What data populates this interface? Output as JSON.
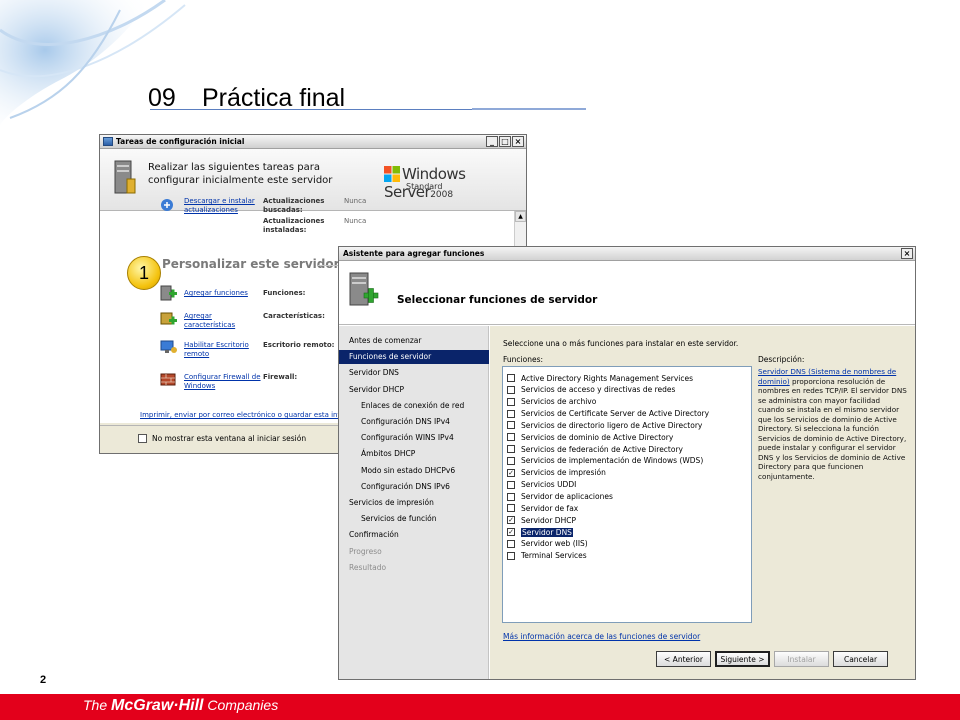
{
  "slide": {
    "number": "09",
    "title": "Práctica final",
    "page": "2",
    "footer_pre": "The ",
    "footer_brand": "McGraw·Hill",
    "footer_post": " Companies"
  },
  "badge": "1",
  "colors": {
    "footer": "#e3001b",
    "selection": "#0a246a",
    "link": "#0033aa"
  },
  "tasks_window": {
    "title": "Tareas de configuración inicial",
    "controls": [
      "_",
      "□",
      "×"
    ],
    "header_text": "Realizar las siguientes tareas para configurar inicialmente este servidor",
    "logo_text": "Windows Server",
    "logo_version": "2008",
    "logo_edition": "Standard",
    "updates": {
      "link": "Descargar e instalar actualizaciones",
      "found_label": "Actualizaciones buscadas:",
      "found_value": "Nunca",
      "installed_label": "Actualizaciones instaladas:",
      "installed_value": "Nunca"
    },
    "section_title": "Personalizar este servidor",
    "tasks": [
      {
        "link": "Agregar funciones",
        "label": "Funciones:"
      },
      {
        "link": "Agregar características",
        "label": "Características:"
      },
      {
        "link": "Habilitar Escritorio remoto",
        "label": "Escritorio remoto:"
      },
      {
        "link": "Configurar Firewall de Windows",
        "label": "Firewall:"
      }
    ],
    "print_link": "Imprimir, enviar por correo electrónico o guardar esta inform",
    "checkbox_label": "No mostrar esta ventana al iniciar sesión"
  },
  "wizard": {
    "title": "Asistente para agregar funciones",
    "close": "×",
    "heading": "Seleccionar funciones de servidor",
    "nav": [
      {
        "label": "Antes de comenzar",
        "level": 0,
        "state": "normal"
      },
      {
        "label": "Funciones de servidor",
        "level": 0,
        "state": "active"
      },
      {
        "label": "Servidor DNS",
        "level": 0,
        "state": "normal"
      },
      {
        "label": "Servidor DHCP",
        "level": 0,
        "state": "normal"
      },
      {
        "label": "Enlaces de conexión de red",
        "level": 1,
        "state": "normal"
      },
      {
        "label": "Configuración DNS IPv4",
        "level": 1,
        "state": "normal"
      },
      {
        "label": "Configuración WINS IPv4",
        "level": 1,
        "state": "normal"
      },
      {
        "label": "Ámbitos DHCP",
        "level": 1,
        "state": "normal"
      },
      {
        "label": "Modo sin estado DHCPv6",
        "level": 1,
        "state": "normal"
      },
      {
        "label": "Configuración DNS IPv6",
        "level": 1,
        "state": "normal"
      },
      {
        "label": "Servicios de impresión",
        "level": 0,
        "state": "normal"
      },
      {
        "label": "Servicios de función",
        "level": 1,
        "state": "normal"
      },
      {
        "label": "Confirmación",
        "level": 0,
        "state": "normal"
      },
      {
        "label": "Progreso",
        "level": 0,
        "state": "disabled"
      },
      {
        "label": "Resultado",
        "level": 0,
        "state": "disabled"
      }
    ],
    "instruction": "Seleccione una o más funciones para instalar en este servidor.",
    "roles_label": "Funciones:",
    "roles": [
      {
        "label": "Active Directory Rights Management Services",
        "checked": false,
        "selected": false
      },
      {
        "label": "Servicios de acceso y directivas de redes",
        "checked": false,
        "selected": false
      },
      {
        "label": "Servicios de archivo",
        "checked": false,
        "selected": false
      },
      {
        "label": "Servicios de Certificate Server de Active Directory",
        "checked": false,
        "selected": false
      },
      {
        "label": "Servicios de directorio ligero de Active Directory",
        "checked": false,
        "selected": false
      },
      {
        "label": "Servicios de dominio de Active Directory",
        "checked": false,
        "selected": false
      },
      {
        "label": "Servicios de federación de Active Directory",
        "checked": false,
        "selected": false
      },
      {
        "label": "Servicios de implementación de Windows (WDS)",
        "checked": false,
        "selected": false
      },
      {
        "label": "Servicios de impresión",
        "checked": true,
        "selected": false
      },
      {
        "label": "Servicios UDDI",
        "checked": false,
        "selected": false
      },
      {
        "label": "Servidor de aplicaciones",
        "checked": false,
        "selected": false
      },
      {
        "label": "Servidor de fax",
        "checked": false,
        "selected": false
      },
      {
        "label": "Servidor DHCP",
        "checked": true,
        "selected": false
      },
      {
        "label": "Servidor DNS",
        "checked": true,
        "selected": true
      },
      {
        "label": "Servidor web (IIS)",
        "checked": false,
        "selected": false
      },
      {
        "label": "Terminal Services",
        "checked": false,
        "selected": false
      }
    ],
    "description_label": "Descripción:",
    "description_link": "Servidor DNS (Sistema de nombres de dominio)",
    "description_text": " proporciona resolución de nombres en redes TCP/IP. El servidor DNS se administra con mayor facilidad cuando se instala en el mismo servidor que los Servicios de dominio de Active Directory. Si selecciona la función Servicios de dominio de Active Directory, puede instalar y configurar el servidor DNS y los Servicios de dominio de Active Directory para que funcionen conjuntamente.",
    "more_link": "Más información acerca de las funciones de servidor",
    "buttons": {
      "back": "< Anterior",
      "next": "Siguiente >",
      "install": "Instalar",
      "cancel": "Cancelar"
    }
  }
}
